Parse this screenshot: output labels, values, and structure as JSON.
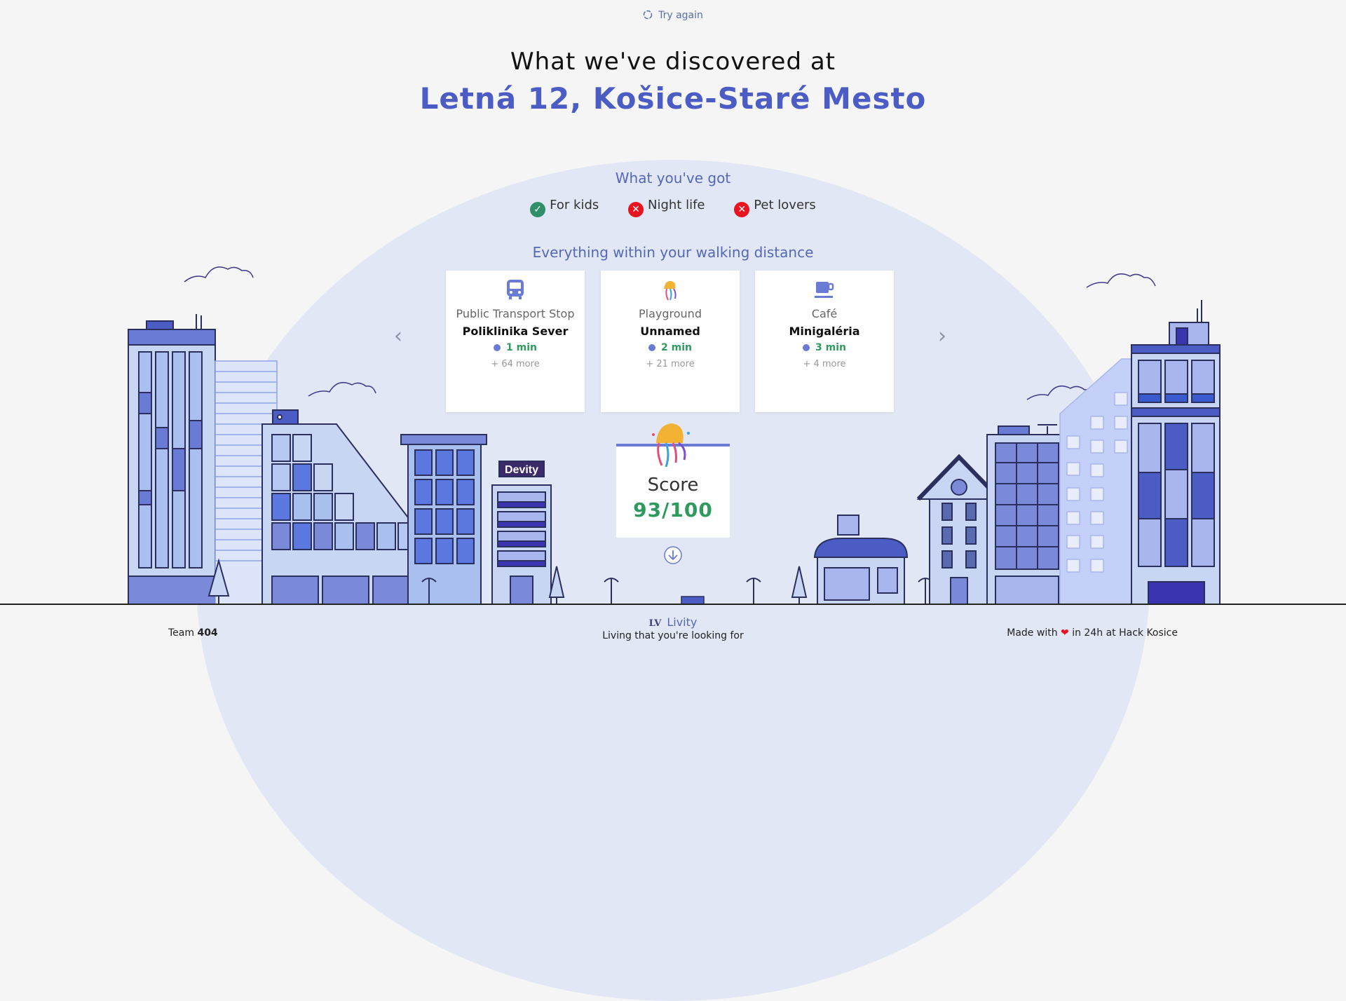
{
  "header": {
    "try_again": "Try again",
    "title_line1": "What we've discovered at",
    "title_line2": "Letná 12, Košice-Staré Mesto"
  },
  "features_section": {
    "title": "What you've got",
    "items": [
      {
        "label": "For kids",
        "available": true
      },
      {
        "label": "Night life",
        "available": false
      },
      {
        "label": "Pet lovers",
        "available": false
      }
    ]
  },
  "walking_section": {
    "title": "Everything within your walking distance",
    "cards": [
      {
        "type": "Public Transport Stop",
        "name": "Poliklinika Sever",
        "time": "1 min",
        "more": "+ 64 more",
        "icon": "bus-icon"
      },
      {
        "type": "Playground",
        "name": "Unnamed",
        "time": "2 min",
        "more": "+ 21 more",
        "icon": "jellyfish-icon"
      },
      {
        "type": "Café",
        "name": "Minigaléria",
        "time": "3 min",
        "more": "+ 4 more",
        "icon": "coffee-cup-icon"
      }
    ],
    "prev": "‹",
    "next": "›"
  },
  "score": {
    "label": "Score",
    "value": "93/100"
  },
  "scene": {
    "sign": "Devity"
  },
  "footer": {
    "team_prefix": "Team ",
    "team_number": "404",
    "logo": "LV",
    "brand": "Livity",
    "tagline": "Living that you're looking for",
    "made_with": "Made with",
    "made_suffix": " in 24h at Hack Kosice"
  },
  "colors": {
    "accent": "#4b5cc4",
    "green": "#2f9a5e",
    "red": "#e8141f",
    "dome": "#e2e7f5"
  }
}
